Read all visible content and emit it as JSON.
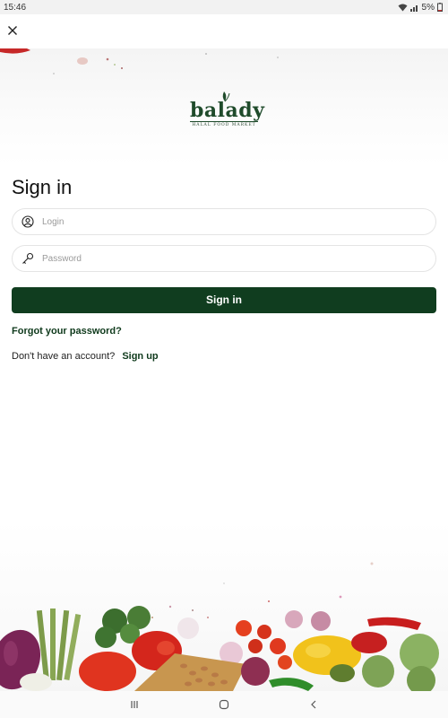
{
  "status_bar": {
    "time": "15:46",
    "battery": "5%"
  },
  "logo": {
    "name": "balady",
    "tagline": "HALAL FOOD MARKET"
  },
  "signin": {
    "title": "Sign in",
    "login_placeholder": "Login",
    "password_placeholder": "Password",
    "button_label": "Sign in",
    "forgot_label": "Forgot your password?",
    "no_account_text": "Don't have an account?",
    "signup_label": "Sign up"
  },
  "icons": {
    "close": "close-icon",
    "login": "user-circle-icon",
    "password": "key-icon",
    "nav_recent": "recent-apps-icon",
    "nav_home": "home-icon",
    "nav_back": "back-icon"
  },
  "colors": {
    "brand_green": "#103d1f",
    "link_green": "#0f3a1c",
    "field_border": "#e4e4e4"
  }
}
